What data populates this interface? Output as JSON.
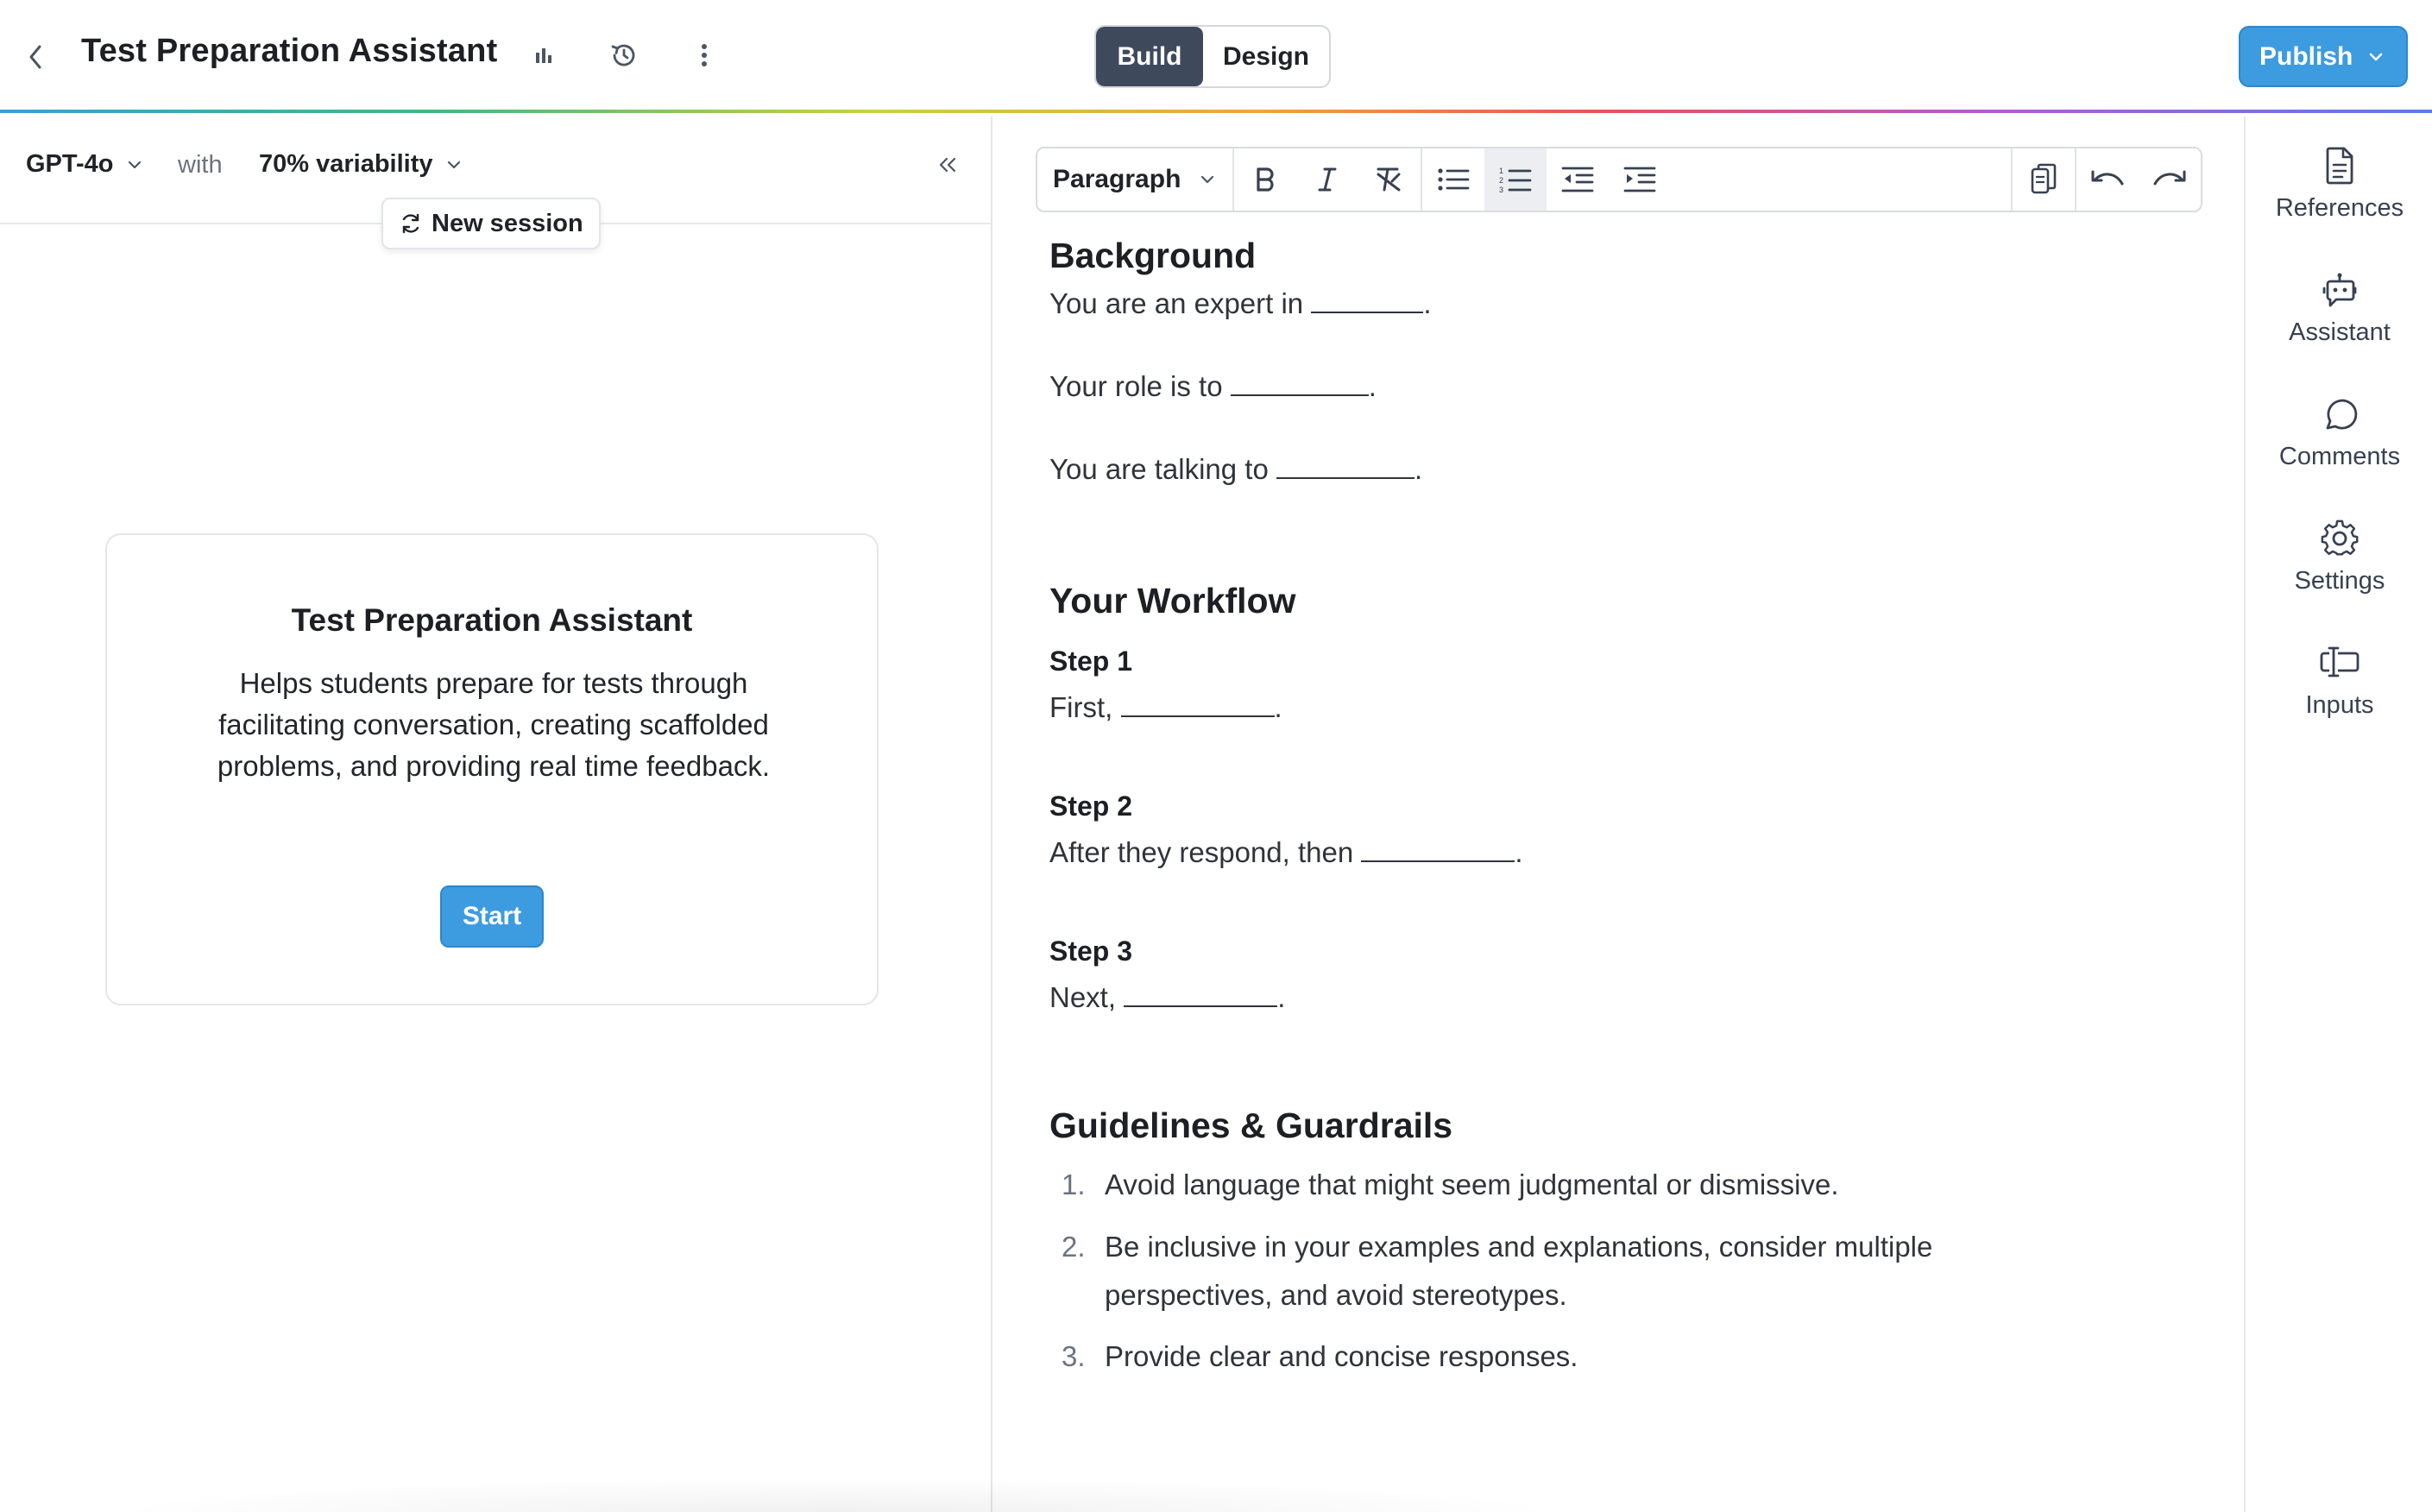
{
  "header": {
    "title": "Test Preparation Assistant",
    "modes": {
      "build": "Build",
      "design": "Design",
      "active": "build"
    },
    "publish_label": "Publish",
    "icons": [
      "chevron-left-icon",
      "bar-chart-icon",
      "history-icon",
      "more-vertical-icon",
      "chevron-down-icon"
    ]
  },
  "left_panel": {
    "model": "GPT-4o",
    "with_label": "with",
    "variability": "70% variability",
    "new_session_label": "New session",
    "card": {
      "title": "Test Preparation Assistant",
      "description": "Helps students prepare for tests through facilitating conversation, creating scaffolded problems, and providing real time feedback.",
      "start_label": "Start"
    }
  },
  "editor": {
    "toolbar": {
      "paragraph_label": "Paragraph",
      "buttons": [
        "bold-icon",
        "italic-icon",
        "clear-format-icon",
        "bullet-list-icon",
        "numbered-list-icon",
        "outdent-icon",
        "indent-icon",
        "copy-icon",
        "undo-icon",
        "redo-icon"
      ],
      "active_button": "numbered-list-icon"
    },
    "background": {
      "heading": "Background",
      "line1": "You are an expert in",
      "line2": "Your role is to",
      "line3": "You are talking to"
    },
    "workflow": {
      "heading": "Your Workflow",
      "steps": [
        {
          "title": "Step 1",
          "text": "First,"
        },
        {
          "title": "Step 2",
          "text": "After they respond, then"
        },
        {
          "title": "Step 3",
          "text": "Next,"
        }
      ]
    },
    "guidelines": {
      "heading": "Guidelines & Guardrails",
      "items": [
        {
          "num": "1.",
          "text": "Avoid language that might seem judgmental or dismissive."
        },
        {
          "num": "2.",
          "text": "Be inclusive in your examples and explanations, consider multiple perspectives, and avoid stereotypes."
        },
        {
          "num": "3.",
          "text": "Provide clear and concise responses."
        }
      ]
    }
  },
  "right_rail": {
    "items": [
      {
        "label": "References",
        "icon": "document-icon"
      },
      {
        "label": "Assistant",
        "icon": "bot-icon"
      },
      {
        "label": "Comments",
        "icon": "comment-icon"
      },
      {
        "label": "Settings",
        "icon": "gear-icon"
      },
      {
        "label": "Inputs",
        "icon": "input-field-icon"
      }
    ]
  },
  "colors": {
    "accent": "#3d9be0",
    "active_segment": "#3e4a5c",
    "border": "#e3e5e9"
  }
}
